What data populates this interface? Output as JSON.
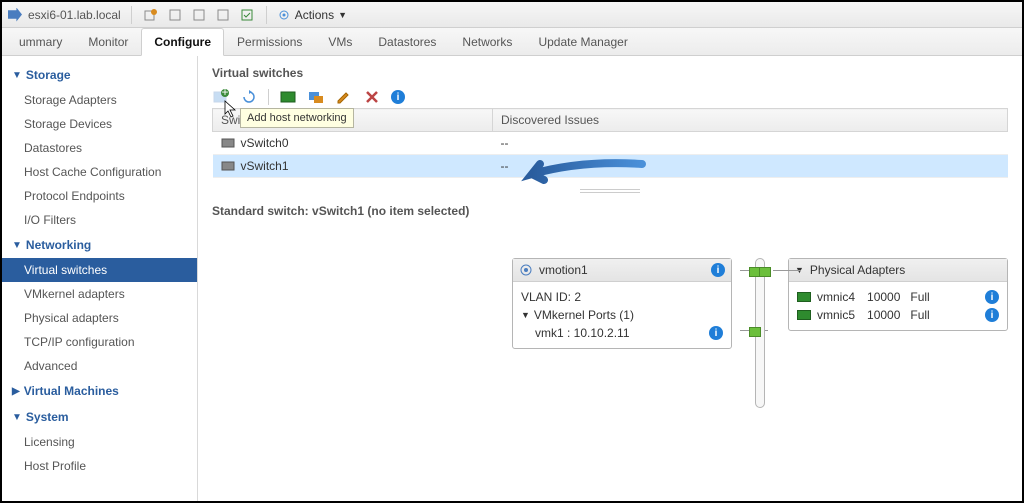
{
  "titlebar": {
    "host_name": "esxi6-01.lab.local",
    "actions_label": "Actions"
  },
  "tabs": [
    "ummary",
    "Monitor",
    "Configure",
    "Permissions",
    "VMs",
    "Datastores",
    "Networks",
    "Update Manager"
  ],
  "active_tab": "Configure",
  "sidebar": {
    "groups": [
      {
        "label": "Storage",
        "expanded": true,
        "items": [
          "Storage Adapters",
          "Storage Devices",
          "Datastores",
          "Host Cache Configuration",
          "Protocol Endpoints",
          "I/O Filters"
        ]
      },
      {
        "label": "Networking",
        "expanded": true,
        "items": [
          "Virtual switches",
          "VMkernel adapters",
          "Physical adapters",
          "TCP/IP configuration",
          "Advanced"
        ]
      },
      {
        "label": "Virtual Machines",
        "expanded": false,
        "items": []
      },
      {
        "label": "System",
        "expanded": true,
        "items": [
          "Licensing",
          "Host Profile"
        ]
      }
    ],
    "selected": "Virtual switches"
  },
  "main": {
    "section_title": "Virtual switches",
    "toolbar_tooltip": "Add host networking",
    "columns": [
      "Switch",
      "Discovered Issues"
    ],
    "rows": [
      {
        "name": "vSwitch0",
        "issues": "--",
        "selected": false
      },
      {
        "name": "vSwitch1",
        "issues": "--",
        "selected": true
      }
    ],
    "detail_title": "Standard switch: vSwitch1 (no item selected)",
    "portgroup": {
      "name": "vmotion1",
      "vlan_label": "VLAN ID: 2",
      "vmk_header": "VMkernel Ports (1)",
      "vmk_line": "vmk1 : 10.10.2.11"
    },
    "physical_adapters": {
      "header": "Physical Adapters",
      "nics": [
        {
          "name": "vmnic4",
          "speed": "10000",
          "duplex": "Full"
        },
        {
          "name": "vmnic5",
          "speed": "10000",
          "duplex": "Full"
        }
      ]
    }
  }
}
